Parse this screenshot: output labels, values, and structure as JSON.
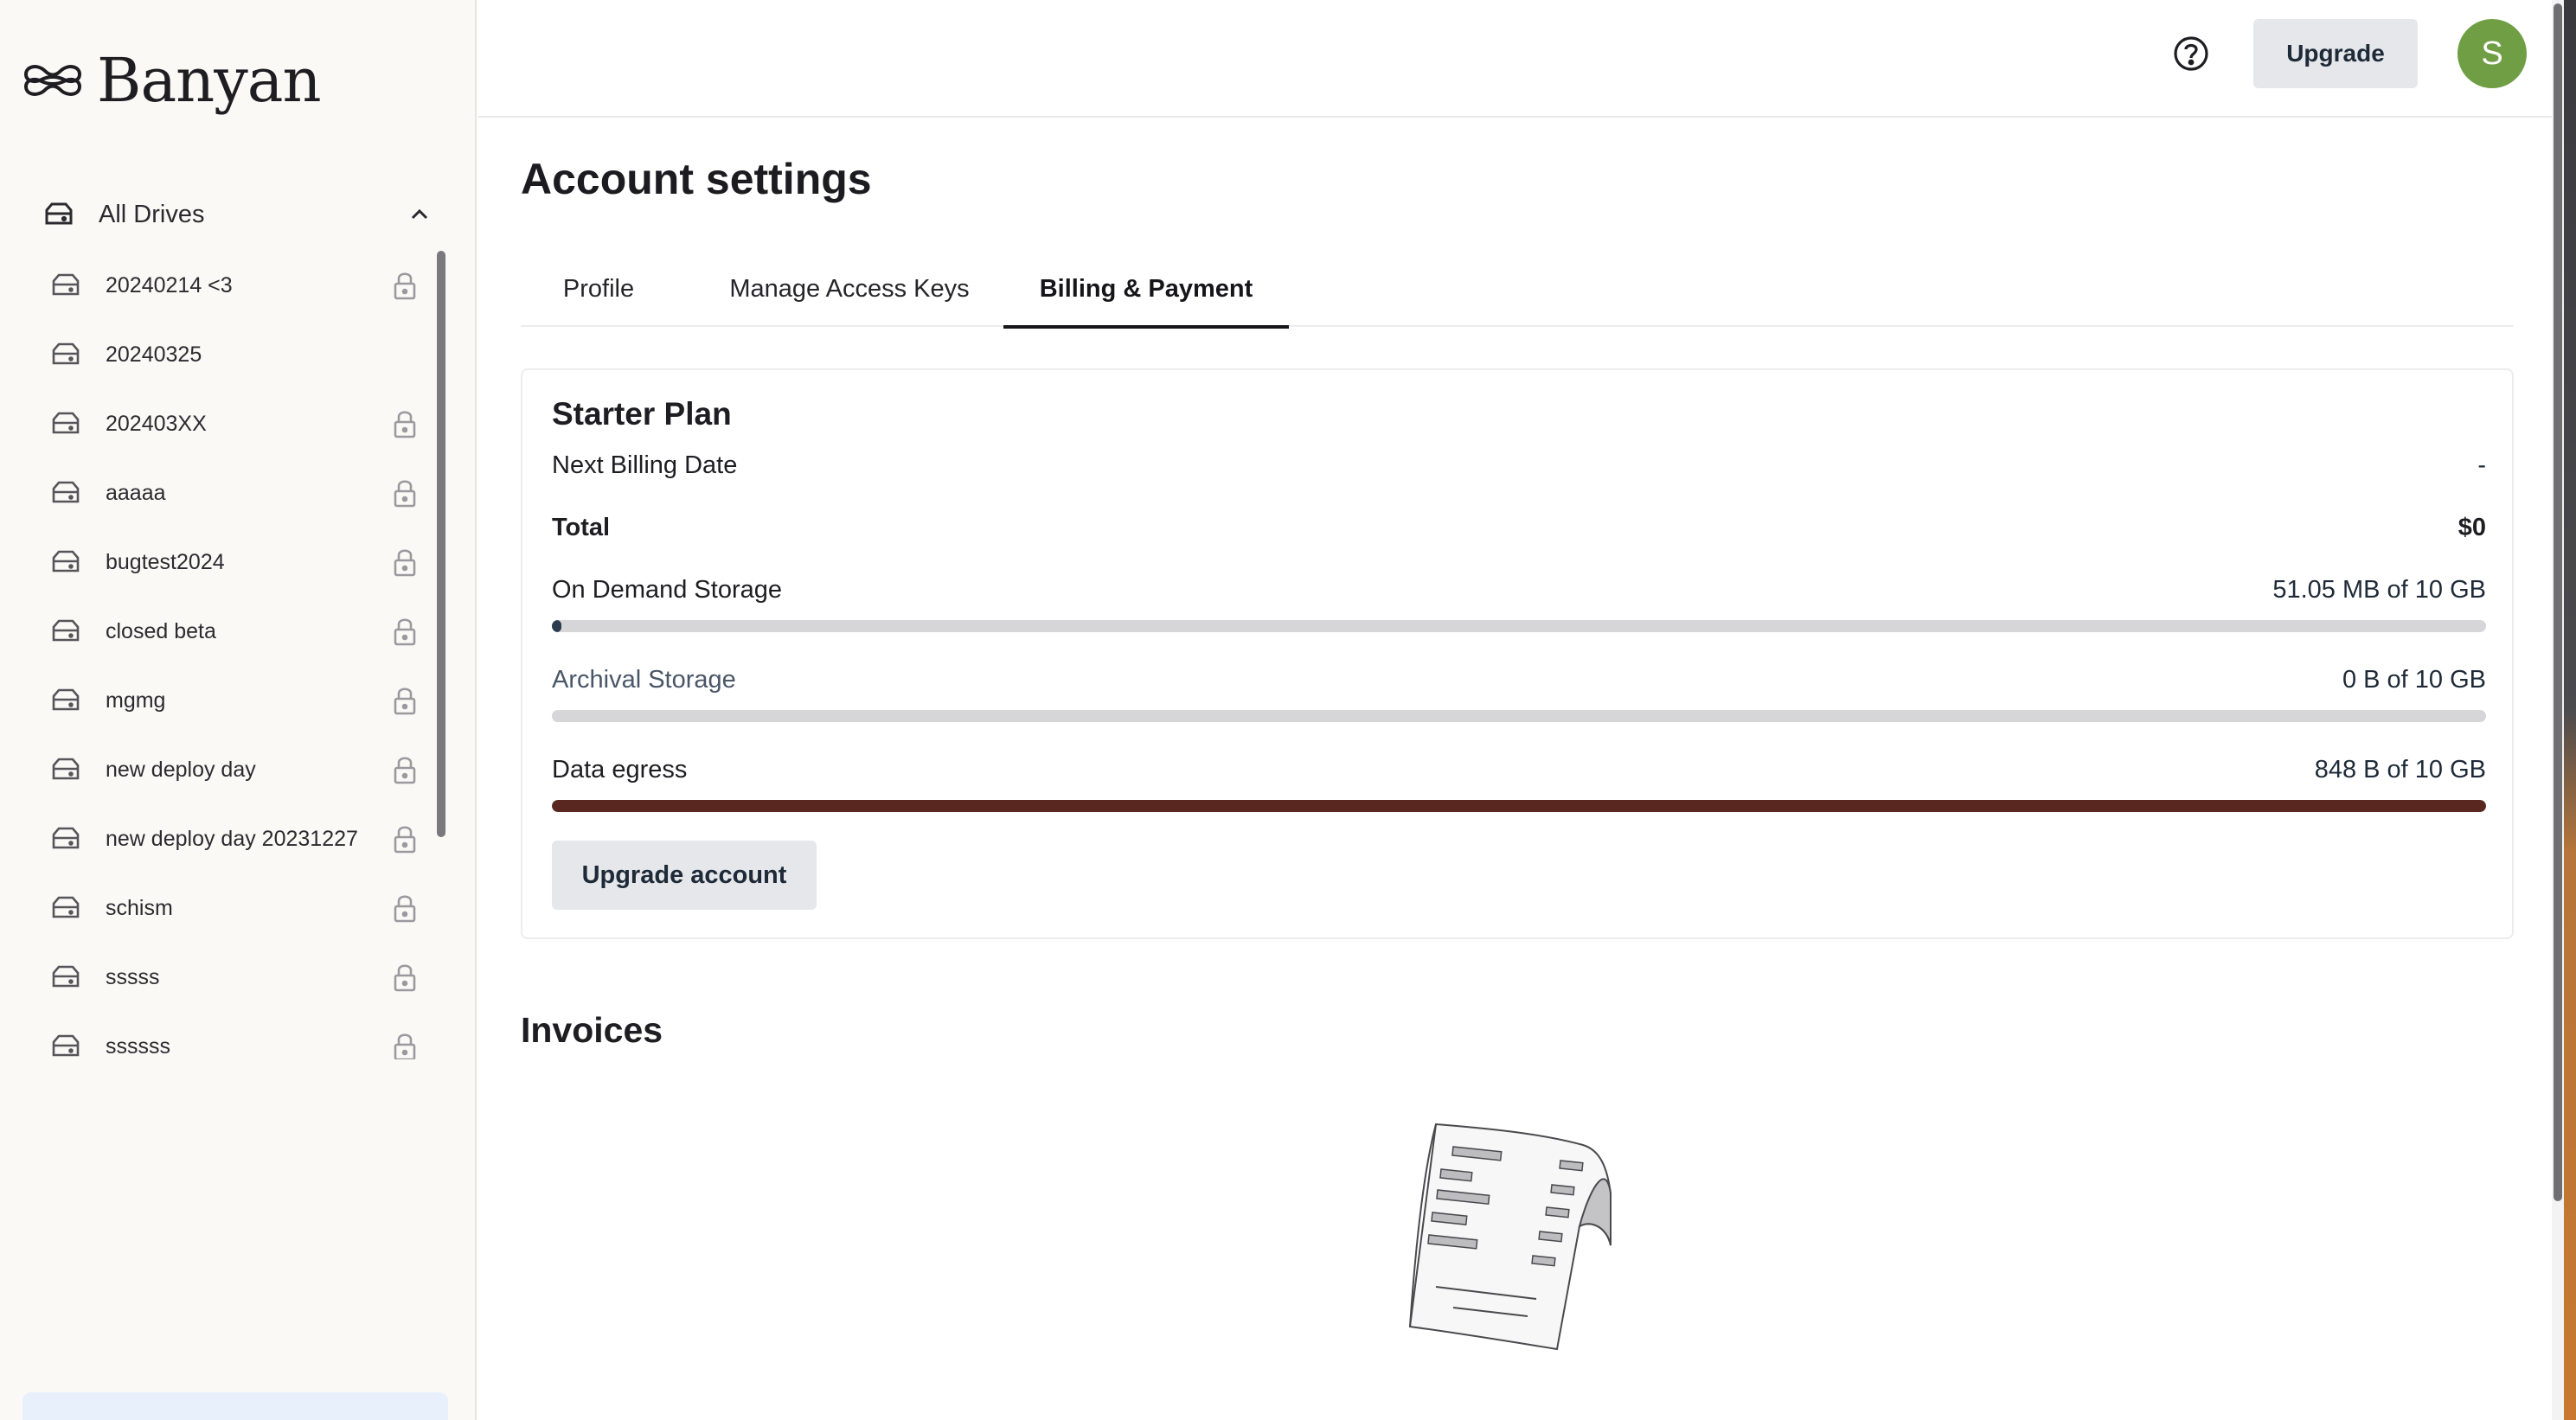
{
  "brand": {
    "name": "Banyan"
  },
  "sidebar": {
    "drives_label": "All Drives",
    "drives": [
      {
        "label": "20240214 <3",
        "locked": true
      },
      {
        "label": "20240325",
        "locked": false
      },
      {
        "label": "202403XX",
        "locked": true
      },
      {
        "label": "aaaaa",
        "locked": true
      },
      {
        "label": "bugtest2024",
        "locked": true
      },
      {
        "label": "closed beta",
        "locked": true
      },
      {
        "label": "mgmg",
        "locked": true
      },
      {
        "label": "new deploy day",
        "locked": true
      },
      {
        "label": "new deploy day 20231227",
        "locked": true
      },
      {
        "label": "schism",
        "locked": true
      },
      {
        "label": "sssss",
        "locked": true
      },
      {
        "label": "ssssss",
        "locked": true
      }
    ]
  },
  "header": {
    "upgrade_label": "Upgrade",
    "avatar_initial": "S",
    "avatar_color": "#6f9e44"
  },
  "page": {
    "title": "Account settings",
    "tabs": [
      {
        "label": "Profile",
        "active": false
      },
      {
        "label": "Manage Access Keys",
        "active": false
      },
      {
        "label": "Billing & Payment",
        "active": true
      }
    ]
  },
  "plan": {
    "name": "Starter Plan",
    "next_billing_label": "Next Billing Date",
    "next_billing_value": "-",
    "total_label": "Total",
    "total_value": "$0",
    "storage": [
      {
        "label": "On Demand Storage",
        "value": "51.05 MB of 10 GB",
        "fraction": 0.005,
        "color": "#2d3b4e"
      },
      {
        "label": "Archival Storage",
        "value": "0 B of 10 GB",
        "fraction": 0.0,
        "color": "#2d3b4e"
      },
      {
        "label": "Data egress",
        "value": "848 B of 10 GB",
        "fraction": 1.0,
        "color": "#5a2620"
      }
    ],
    "upgrade_account_label": "Upgrade account"
  },
  "invoices": {
    "title": "Invoices"
  }
}
